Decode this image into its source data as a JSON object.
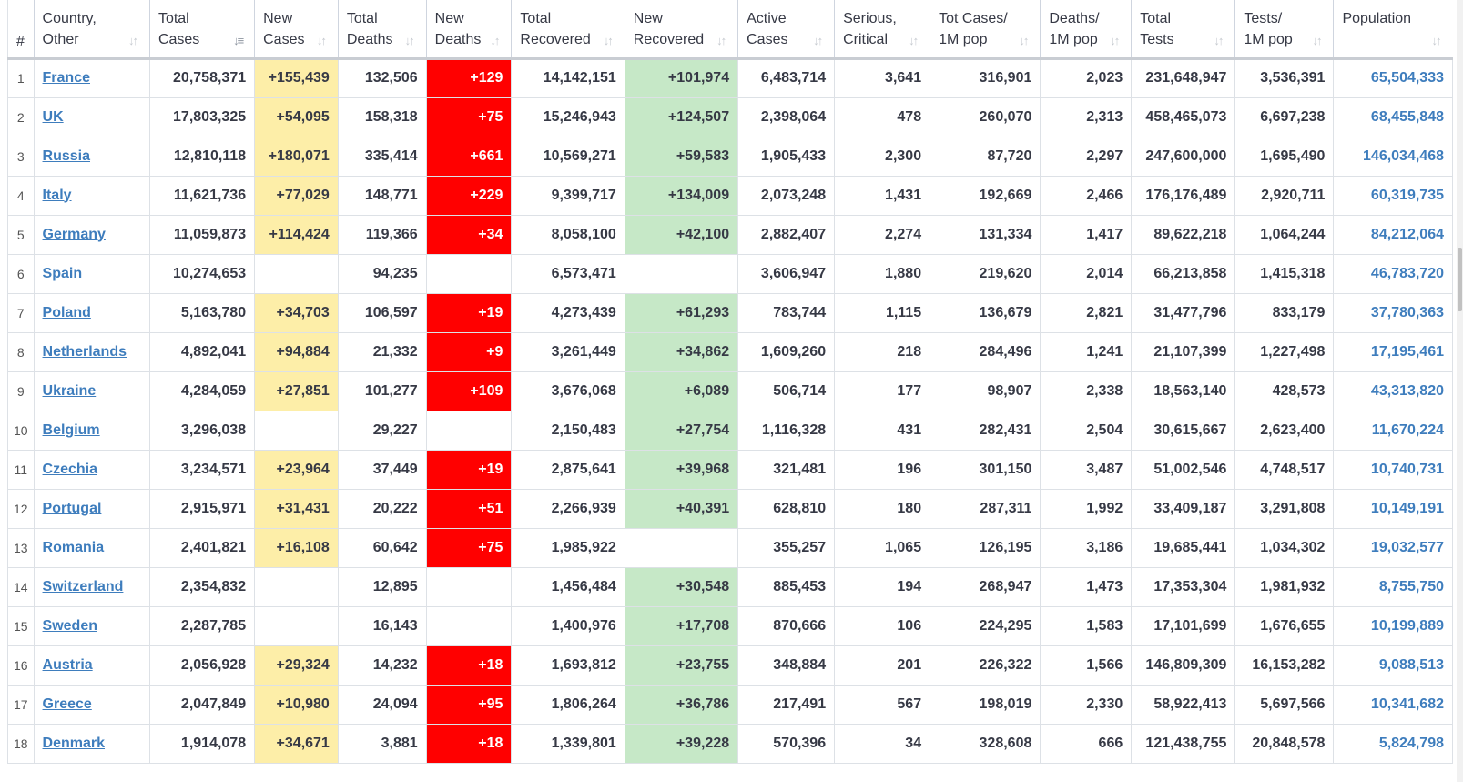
{
  "table": {
    "headers": [
      {
        "key": "rank",
        "line1": "#",
        "line2": ""
      },
      {
        "key": "country",
        "line1": "Country,",
        "line2": "Other"
      },
      {
        "key": "total_cases",
        "line1": "Total",
        "line2": "Cases"
      },
      {
        "key": "new_cases",
        "line1": "New",
        "line2": "Cases"
      },
      {
        "key": "total_deaths",
        "line1": "Total",
        "line2": "Deaths"
      },
      {
        "key": "new_deaths",
        "line1": "New",
        "line2": "Deaths"
      },
      {
        "key": "total_recovered",
        "line1": "Total",
        "line2": "Recovered"
      },
      {
        "key": "new_recovered",
        "line1": "New",
        "line2": "Recovered"
      },
      {
        "key": "active_cases",
        "line1": "Active",
        "line2": "Cases"
      },
      {
        "key": "serious_critical",
        "line1": "Serious,",
        "line2": "Critical"
      },
      {
        "key": "cases_per_1m",
        "line1": "Tot Cases/",
        "line2": "1M pop"
      },
      {
        "key": "deaths_per_1m",
        "line1": "Deaths/",
        "line2": "1M pop"
      },
      {
        "key": "total_tests",
        "line1": "Total",
        "line2": "Tests"
      },
      {
        "key": "tests_per_1m",
        "line1": "Tests/",
        "line2": "1M pop"
      },
      {
        "key": "population",
        "line1": "Population",
        "line2": ""
      }
    ],
    "sorted_column": "total_cases",
    "rows": [
      [
        "1",
        "France",
        "20,758,371",
        "+155,439",
        "132,506",
        "+129",
        "14,142,151",
        "+101,974",
        "6,483,714",
        "3,641",
        "316,901",
        "2,023",
        "231,648,947",
        "3,536,391",
        "65,504,333"
      ],
      [
        "2",
        "UK",
        "17,803,325",
        "+54,095",
        "158,318",
        "+75",
        "15,246,943",
        "+124,507",
        "2,398,064",
        "478",
        "260,070",
        "2,313",
        "458,465,073",
        "6,697,238",
        "68,455,848"
      ],
      [
        "3",
        "Russia",
        "12,810,118",
        "+180,071",
        "335,414",
        "+661",
        "10,569,271",
        "+59,583",
        "1,905,433",
        "2,300",
        "87,720",
        "2,297",
        "247,600,000",
        "1,695,490",
        "146,034,468"
      ],
      [
        "4",
        "Italy",
        "11,621,736",
        "+77,029",
        "148,771",
        "+229",
        "9,399,717",
        "+134,009",
        "2,073,248",
        "1,431",
        "192,669",
        "2,466",
        "176,176,489",
        "2,920,711",
        "60,319,735"
      ],
      [
        "5",
        "Germany",
        "11,059,873",
        "+114,424",
        "119,366",
        "+34",
        "8,058,100",
        "+42,100",
        "2,882,407",
        "2,274",
        "131,334",
        "1,417",
        "89,622,218",
        "1,064,244",
        "84,212,064"
      ],
      [
        "6",
        "Spain",
        "10,274,653",
        "",
        "94,235",
        "",
        "6,573,471",
        "",
        "3,606,947",
        "1,880",
        "219,620",
        "2,014",
        "66,213,858",
        "1,415,318",
        "46,783,720"
      ],
      [
        "7",
        "Poland",
        "5,163,780",
        "+34,703",
        "106,597",
        "+19",
        "4,273,439",
        "+61,293",
        "783,744",
        "1,115",
        "136,679",
        "2,821",
        "31,477,796",
        "833,179",
        "37,780,363"
      ],
      [
        "8",
        "Netherlands",
        "4,892,041",
        "+94,884",
        "21,332",
        "+9",
        "3,261,449",
        "+34,862",
        "1,609,260",
        "218",
        "284,496",
        "1,241",
        "21,107,399",
        "1,227,498",
        "17,195,461"
      ],
      [
        "9",
        "Ukraine",
        "4,284,059",
        "+27,851",
        "101,277",
        "+109",
        "3,676,068",
        "+6,089",
        "506,714",
        "177",
        "98,907",
        "2,338",
        "18,563,140",
        "428,573",
        "43,313,820"
      ],
      [
        "10",
        "Belgium",
        "3,296,038",
        "",
        "29,227",
        "",
        "2,150,483",
        "+27,754",
        "1,116,328",
        "431",
        "282,431",
        "2,504",
        "30,615,667",
        "2,623,400",
        "11,670,224"
      ],
      [
        "11",
        "Czechia",
        "3,234,571",
        "+23,964",
        "37,449",
        "+19",
        "2,875,641",
        "+39,968",
        "321,481",
        "196",
        "301,150",
        "3,487",
        "51,002,546",
        "4,748,517",
        "10,740,731"
      ],
      [
        "12",
        "Portugal",
        "2,915,971",
        "+31,431",
        "20,222",
        "+51",
        "2,266,939",
        "+40,391",
        "628,810",
        "180",
        "287,311",
        "1,992",
        "33,409,187",
        "3,291,808",
        "10,149,191"
      ],
      [
        "13",
        "Romania",
        "2,401,821",
        "+16,108",
        "60,642",
        "+75",
        "1,985,922",
        "",
        "355,257",
        "1,065",
        "126,195",
        "3,186",
        "19,685,441",
        "1,034,302",
        "19,032,577"
      ],
      [
        "14",
        "Switzerland",
        "2,354,832",
        "",
        "12,895",
        "",
        "1,456,484",
        "+30,548",
        "885,453",
        "194",
        "268,947",
        "1,473",
        "17,353,304",
        "1,981,932",
        "8,755,750"
      ],
      [
        "15",
        "Sweden",
        "2,287,785",
        "",
        "16,143",
        "",
        "1,400,976",
        "+17,708",
        "870,666",
        "106",
        "224,295",
        "1,583",
        "17,101,699",
        "1,676,655",
        "10,199,889"
      ],
      [
        "16",
        "Austria",
        "2,056,928",
        "+29,324",
        "14,232",
        "+18",
        "1,693,812",
        "+23,755",
        "348,884",
        "201",
        "226,322",
        "1,566",
        "146,809,309",
        "16,153,282",
        "9,088,513"
      ],
      [
        "17",
        "Greece",
        "2,047,849",
        "+10,980",
        "24,094",
        "+95",
        "1,806,264",
        "+36,786",
        "217,491",
        "567",
        "198,019",
        "2,330",
        "58,922,413",
        "5,697,566",
        "10,341,682"
      ],
      [
        "18",
        "Denmark",
        "1,914,078",
        "+34,671",
        "3,881",
        "+18",
        "1,339,801",
        "+39,228",
        "570,396",
        "34",
        "328,608",
        "666",
        "121,438,755",
        "20,848,578",
        "5,824,798"
      ]
    ]
  },
  "colors": {
    "new_cases_highlight": "#fdeea8",
    "new_deaths_highlight": "#ff0000",
    "new_recovered_highlight": "#c6e8c7",
    "link": "#3e7dbd"
  },
  "icons": {
    "sort": "sort-arrows-icon",
    "sort_active": "sort-descending-icon"
  }
}
